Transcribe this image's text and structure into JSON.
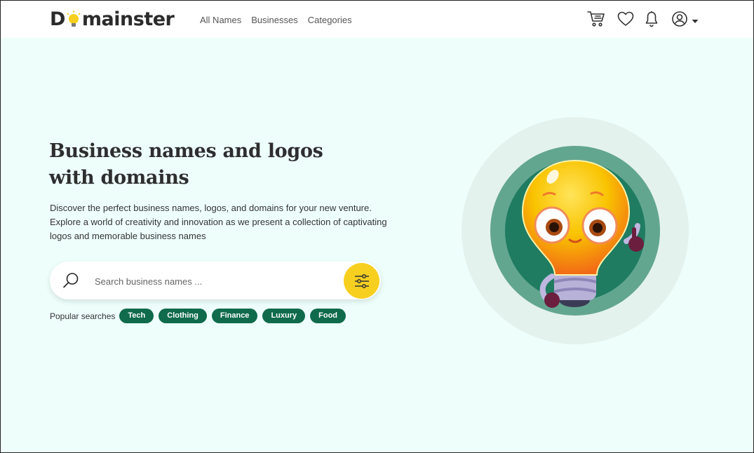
{
  "brand": {
    "logo_left": "D",
    "logo_right": "mainster"
  },
  "nav": {
    "items": [
      "All Names",
      "Businesses",
      "Categories"
    ]
  },
  "header_icons": [
    "cart-icon",
    "heart-icon",
    "bell-icon",
    "user-icon",
    "caret-down-icon"
  ],
  "hero": {
    "title_line1": "Business names and logos",
    "title_line2": "with domains",
    "description_line1": "Discover the perfect business names, logos, and domains for your new venture.",
    "description_line2": "Explore a world of creativity and innovation as we present a collection of captivating",
    "description_line3": "logos and memorable business names"
  },
  "search": {
    "placeholder": "Search business names ...",
    "value": ""
  },
  "popular": {
    "label": "Popular searches",
    "tags": [
      "Tech",
      "Clothing",
      "Finance",
      "Luxury",
      "Food"
    ]
  },
  "colors": {
    "accent_yellow": "#f7cf1f",
    "chip_green": "#0f6b4b",
    "page_bg": "#eefffb",
    "circle_outer": "#e4f2ee",
    "circle_mid": "#63a690",
    "circle_inner": "#1f7c61"
  }
}
